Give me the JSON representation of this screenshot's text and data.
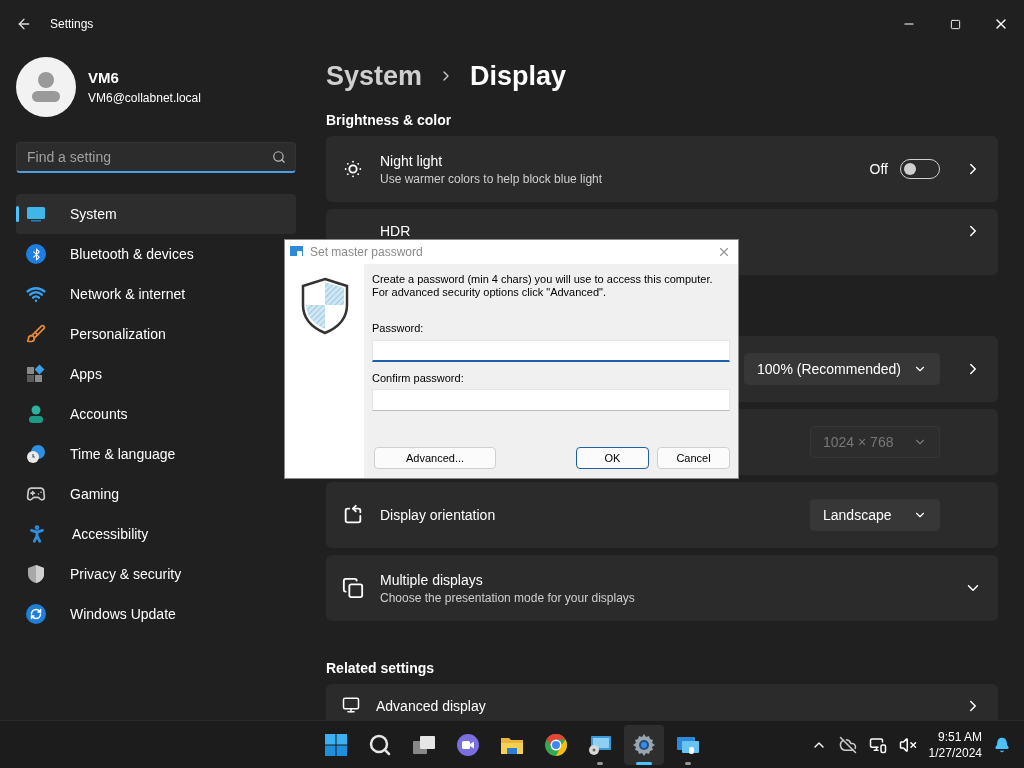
{
  "window": {
    "title": "Settings"
  },
  "user": {
    "name": "VM6",
    "email": "VM6@collabnet.local"
  },
  "search": {
    "placeholder": "Find a setting"
  },
  "sidebar": {
    "items": [
      {
        "label": "System",
        "selected": true
      },
      {
        "label": "Bluetooth & devices",
        "selected": false
      },
      {
        "label": "Network & internet",
        "selected": false
      },
      {
        "label": "Personalization",
        "selected": false
      },
      {
        "label": "Apps",
        "selected": false
      },
      {
        "label": "Accounts",
        "selected": false
      },
      {
        "label": "Time & language",
        "selected": false
      },
      {
        "label": "Gaming",
        "selected": false
      },
      {
        "label": "Accessibility",
        "selected": false
      },
      {
        "label": "Privacy & security",
        "selected": false
      },
      {
        "label": "Windows Update",
        "selected": false
      }
    ]
  },
  "breadcrumb": {
    "parent": "System",
    "current": "Display"
  },
  "content": [
    {
      "kind": "section",
      "title": "Brightness & color"
    },
    {
      "kind": "link_card",
      "title": "Night light",
      "subtitle": "Use warmer colors to help block blue light",
      "control": {
        "kind": "toggle",
        "label": "Off",
        "on": false
      }
    },
    {
      "kind": "link_card",
      "title": "HDR"
    },
    {
      "kind": "gap"
    },
    {
      "kind": "link_card",
      "control": {
        "kind": "dropdown",
        "value": "100% (Recommended)",
        "disabled": false
      }
    },
    {
      "kind": "plain_card",
      "control": {
        "kind": "dropdown",
        "value": "1024 × 768",
        "disabled": true
      }
    },
    {
      "kind": "plain_card",
      "title": "Display orientation",
      "control": {
        "kind": "dropdown",
        "value": "Landscape",
        "disabled": false
      }
    },
    {
      "kind": "expand_card",
      "title": "Multiple displays",
      "subtitle": "Choose the presentation mode for your displays",
      "expanded": false
    },
    {
      "kind": "section",
      "title": "Related settings"
    },
    {
      "kind": "link_card",
      "title": "Advanced display"
    }
  ],
  "dialog": {
    "title": "Set master password",
    "message": "Create a password (min 4 chars) you will use to access this computer. For advanced security options click \"Advanced\".",
    "fields": [
      {
        "label": "Password:",
        "focused": true
      },
      {
        "label": "Confirm password:",
        "focused": false
      }
    ],
    "buttons": [
      {
        "label": "Advanced...",
        "default": false
      },
      {
        "label": "OK",
        "default": true
      },
      {
        "label": "Cancel",
        "default": false
      }
    ]
  },
  "taskbar": {
    "apps": [
      {
        "running": false,
        "active": false
      },
      {
        "running": false,
        "active": false
      },
      {
        "running": false,
        "active": false
      },
      {
        "running": false,
        "active": false
      },
      {
        "running": false,
        "active": false
      },
      {
        "running": false,
        "active": false
      },
      {
        "running": true,
        "active": false
      },
      {
        "running": true,
        "active": true
      },
      {
        "running": true,
        "active": false
      }
    ],
    "time": "9:51 AM",
    "date": "1/27/2024"
  }
}
